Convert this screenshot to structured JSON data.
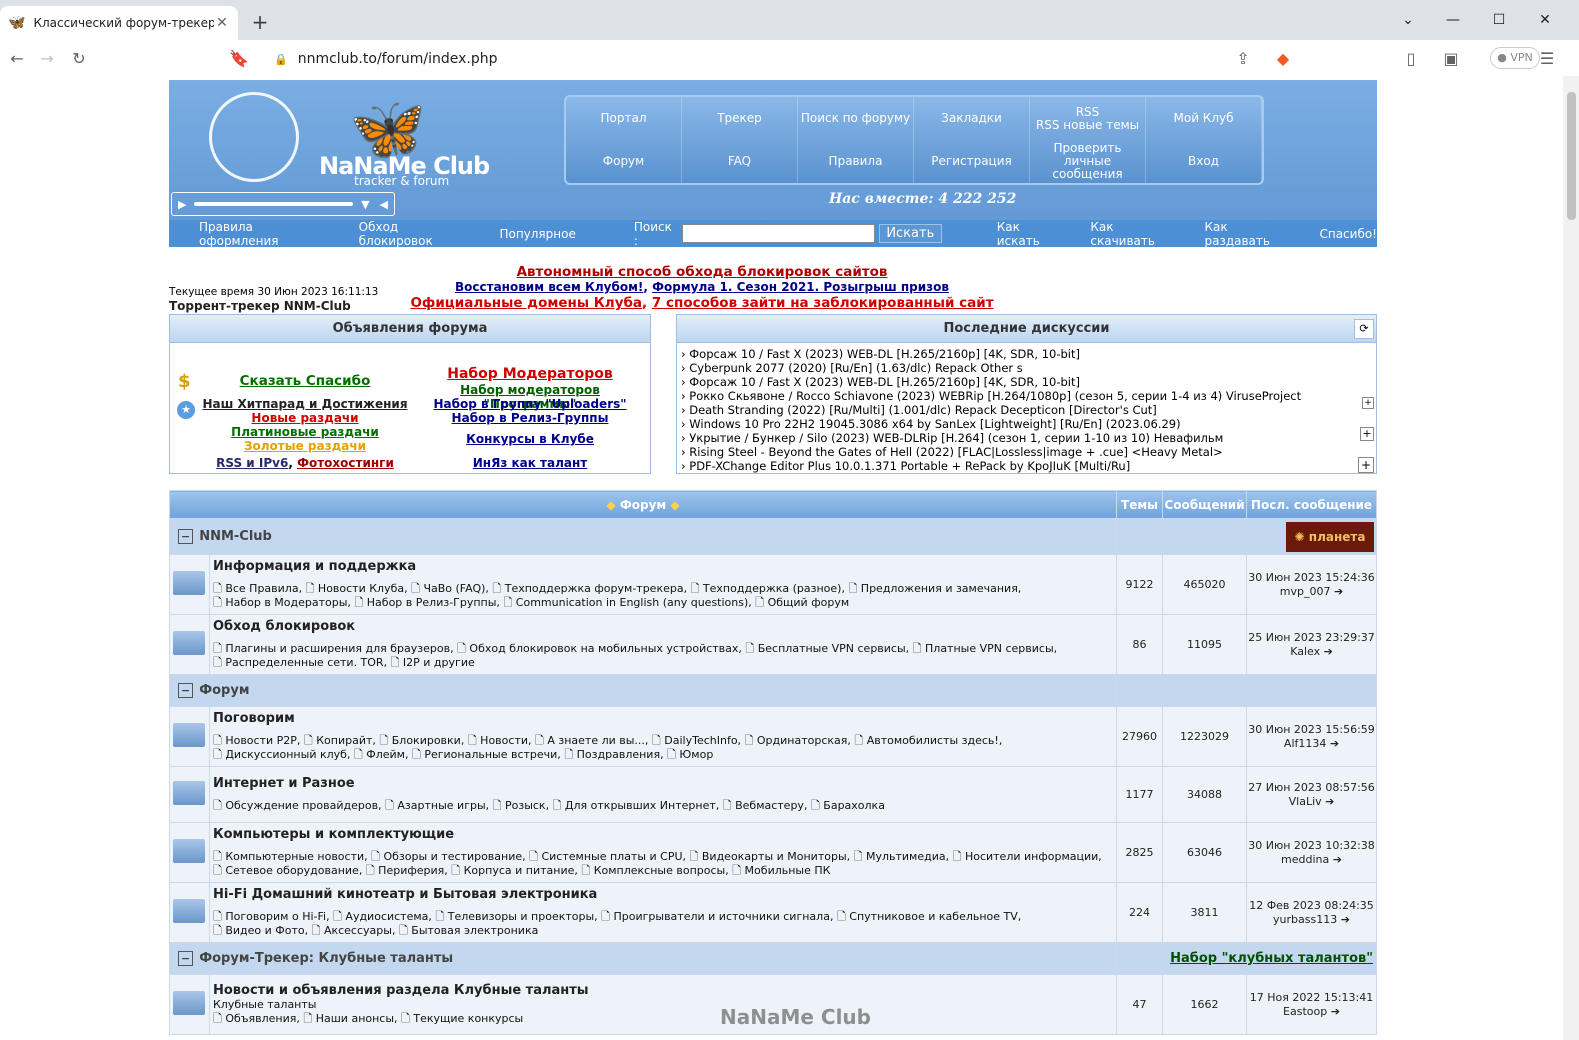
{
  "browser": {
    "tab_title": "Классический форум-трекер :: N",
    "url": "nnmclub.to/forum/index.php",
    "vpn_label": "● VPN",
    "new_tab": "+",
    "close": "✕",
    "minimize": "⌄",
    "icons": {
      "back": "arrow-left-icon",
      "forward": "arrow-right-icon",
      "reload": "reload-icon",
      "bookmark": "bookmark-icon",
      "lock": "lock-icon",
      "share": "share-icon",
      "brave": "brave-icon",
      "menu": "menu-icon"
    }
  },
  "header": {
    "logo_name": "NaNaMe Club",
    "logo_sub": "tracker & forum",
    "nav": [
      "Портал",
      "Трекер",
      "Поиск по форуму",
      "Закладки",
      "RSS\nRSS новые темы",
      "Мой Клуб",
      "Форум",
      "FAQ",
      "Правила",
      "Регистрация",
      "Проверить личные сообщения",
      "Вход"
    ],
    "together": "Нас вместе: 4 222 252",
    "subnav_left": [
      "Правила оформления",
      "Обход блокировок",
      "Популярное"
    ],
    "search_label": "Поиск :",
    "search_button": "Искать",
    "subnav_right": [
      "Как искать",
      "Как скачивать",
      "Как раздавать",
      "Спасибо!"
    ]
  },
  "notice": {
    "line1": "Автономный способ обхода блокировок сайтов",
    "line2a": "Восстановим всем Клубом!",
    "line2b": "Формула 1. Сезон 2021. Розыгрыш призов",
    "line3a": "Официальные домены Клуба",
    "line3b": "7 способов зайти на заблокированный сайт",
    "current_time": "Текущее время 30 Июн 2023 16:11:13",
    "tracker": "Торрент-трекер NNM-Club"
  },
  "announcements": {
    "title": "Объявления форума",
    "left": [
      "Сказать Спасибо",
      "Наш Хитпарад и Достижения",
      "Новые раздачи",
      "Платиновые раздачи",
      "Золотые раздачи",
      "RSS и IPv6",
      "Фотохостинги"
    ],
    "right": [
      "Набор Модераторов",
      "Набор модераторов \"Программы\"",
      "Набор в Группу \"Uploaders\"",
      "Набор в Релиз-Группы",
      "Конкурсы в Клубе",
      "ИнЯз как талант"
    ]
  },
  "discussions": {
    "title": "Последние дискуссии",
    "items": [
      "› Форсаж 10 / Fast X (2023) WEB-DL [H.265/2160p] [4K, SDR, 10-bit]",
      "› Cyberpunk 2077 (2020) [Ru/En] (1.63/dlc) Repack Other s",
      "› Форсаж 10 / Fast X (2023) WEB-DL [H.265/2160p] [4K, SDR, 10-bit]",
      "› Рокко Скьявоне / Rocco Schiavone (2023) WEBRip [H.264/1080p] (сезон 5, серии 1-4 из 4) ViruseProject",
      "› Death Stranding (2022) [Ru/Multi] (1.001/dlc) Repack Decepticon [Director's Cut]",
      "› Windows 10 Pro 22H2 19045.3086 x64 by SanLex [Lightweight] [Ru/En] (2023.06.29)",
      "› Укрытие / Бункер / Silo (2023) WEB-DLRip [H.264] (сезон 1, серии 1-10 из 10) Невафильм",
      "› Rising Steel - Beyond the Gates of Hell (2022) [FLAC|Lossless|image + .cue] <Heavy Metal>",
      "› PDF-XChange Editor Plus 10.0.1.371 Portable + RePack by KpoJIuK [Multi/Ru]"
    ]
  },
  "forum": {
    "headers": [
      "Форум",
      "Темы",
      "Сообщений",
      "Посл. сообщение"
    ],
    "categories": [
      {
        "name": "NNM-Club",
        "forums": [
          {
            "title": "Информация и поддержка",
            "subs": "Все Правила, Новости Клуба, ЧаВо (FAQ), Техподдержка форум-трекера, Техподдержка (разное), Предложения и замечания,",
            "subs2": "Набор в Модераторы, Набор в Релиз-Группы, Communication in English (any questions), Общий форум",
            "topics": "9122",
            "posts": "465020",
            "last_date": "30 Июн 2023 15:24:36",
            "last_user": "mvp_007"
          },
          {
            "title": "Обход блокировок",
            "subs": "Плагины и расширения для браузеров, Обход блокировок на мобильных устройствах, Бесплатные VPN сервисы, Платные VPN сервисы,",
            "subs2": "Распределенные сети. TOR, I2P и другие",
            "topics": "86",
            "posts": "11095",
            "last_date": "25 Июн 2023 23:29:37",
            "last_user": "Kalex"
          }
        ]
      },
      {
        "name": "Форум",
        "forums": [
          {
            "title": "Поговорим",
            "subs": "Новости P2P, Копирайт, Блокировки, Новости, А знаете ли вы..., DailyTechInfo, Ординаторская, Автомобилисты здесь!,",
            "subs2": "Дискуссионный клуб, Флейм, Региональные встречи, Поздравления, Юмор",
            "topics": "27960",
            "posts": "1223029",
            "last_date": "30 Июн 2023 15:56:59",
            "last_user": "Alf1134"
          },
          {
            "title": "Интернет и Разное",
            "subs": "Обсуждение провайдеров, Азартные игры, Розыск, Для открывших Интернет, Вебмастеру, Барахолка",
            "subs2": "",
            "topics": "1177",
            "posts": "34088",
            "last_date": "27 Июн 2023 08:57:56",
            "last_user": "VlaLiv"
          },
          {
            "title": "Компьютеры и комплектующие",
            "subs": "Компьютерные новости, Обзоры и тестирование, Системные платы и CPU, Видеокарты и Мониторы, Мультимедиа, Носители информации,",
            "subs2": "Сетевое оборудование, Периферия, Корпуса и питание, Комплексные вопросы, Мобильные ПК",
            "topics": "2825",
            "posts": "63046",
            "last_date": "30 Июн 2023 10:32:38",
            "last_user": "meddina"
          },
          {
            "title": "Hi-Fi Домашний кинотеатр и Бытовая электроника",
            "subs": "Поговорим о Hi-Fi, Аудиосистема, Телевизоры и проекторы, Проигрыватели и источники сигнала, Спутниковое и кабельное TV,",
            "subs2": "Видео и Фото, Аксессуары, Бытовая электроника",
            "topics": "224",
            "posts": "3811",
            "last_date": "12 Фев 2023 08:24:35",
            "last_user": "yurbass113"
          }
        ]
      },
      {
        "name": "Форум-Трекер: Клубные таланты",
        "right_link": "Набор \"клубных талантов\"",
        "forums": [
          {
            "title": "Новости и объявления раздела Клубные таланты",
            "desc": "Клубные таланты",
            "subs": "Объявления, Наши анонсы, Текущие конкурсы",
            "subs2": "",
            "topics": "47",
            "posts": "1662",
            "last_date": "17 Ноя 2022 15:13:41",
            "last_user": "Eastoop"
          }
        ]
      }
    ]
  },
  "watermark": "NaNaMe Club"
}
